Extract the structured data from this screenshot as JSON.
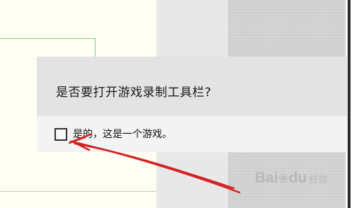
{
  "dialog": {
    "question": "是否要打开游戏录制工具栏?",
    "checkbox_label": "是的，这是一个游戏。",
    "checkbox_checked": false
  },
  "watermark": {
    "part1": "Bai",
    "paw_icon": "paw-icon",
    "part2": "du",
    "part3": "经验"
  },
  "annotation": {
    "arrow_color": "#d32222",
    "arrow_icon": "red-arrow-icon"
  }
}
